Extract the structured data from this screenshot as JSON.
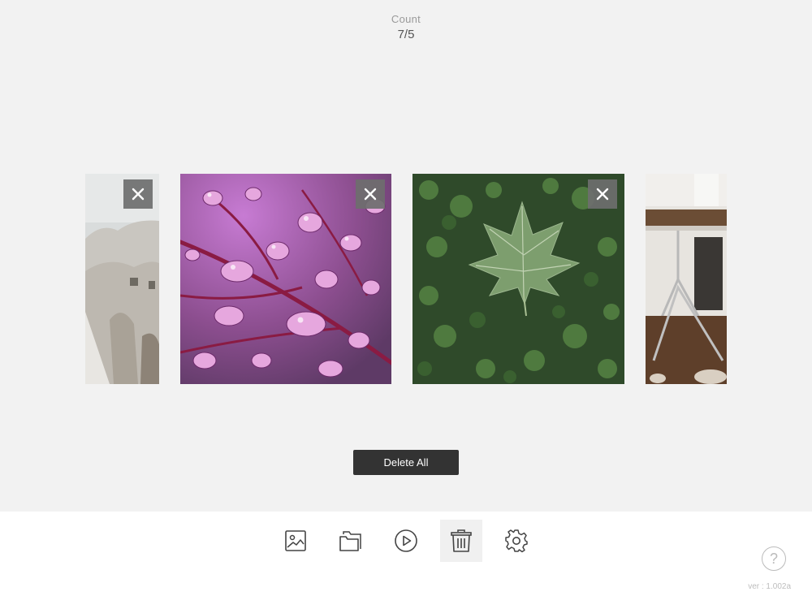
{
  "header": {
    "count_label": "Count",
    "count_value": "7/5"
  },
  "gallery": {
    "items": [
      {
        "subject": "white rock formations",
        "partial": true
      },
      {
        "subject": "water drops on purple leaf",
        "partial": false
      },
      {
        "subject": "green maple leaf on clover",
        "partial": false
      },
      {
        "subject": "wooden table and chair",
        "partial": true
      }
    ],
    "remove_icon": "close-icon"
  },
  "actions": {
    "delete_all_label": "Delete All"
  },
  "toolbar": {
    "tools": [
      {
        "name": "image-icon",
        "active": false
      },
      {
        "name": "folder-icon",
        "active": false
      },
      {
        "name": "play-icon",
        "active": false
      },
      {
        "name": "trash-icon",
        "active": true
      },
      {
        "name": "gear-icon",
        "active": false
      }
    ]
  },
  "footer": {
    "help_icon": "help-icon",
    "help_glyph": "?",
    "version": "ver : 1.002a"
  },
  "colors": {
    "background": "#f2f2f2",
    "toolbar": "#ffffff",
    "button_dark": "#333333",
    "remove_overlay": "#6e6e6e"
  }
}
